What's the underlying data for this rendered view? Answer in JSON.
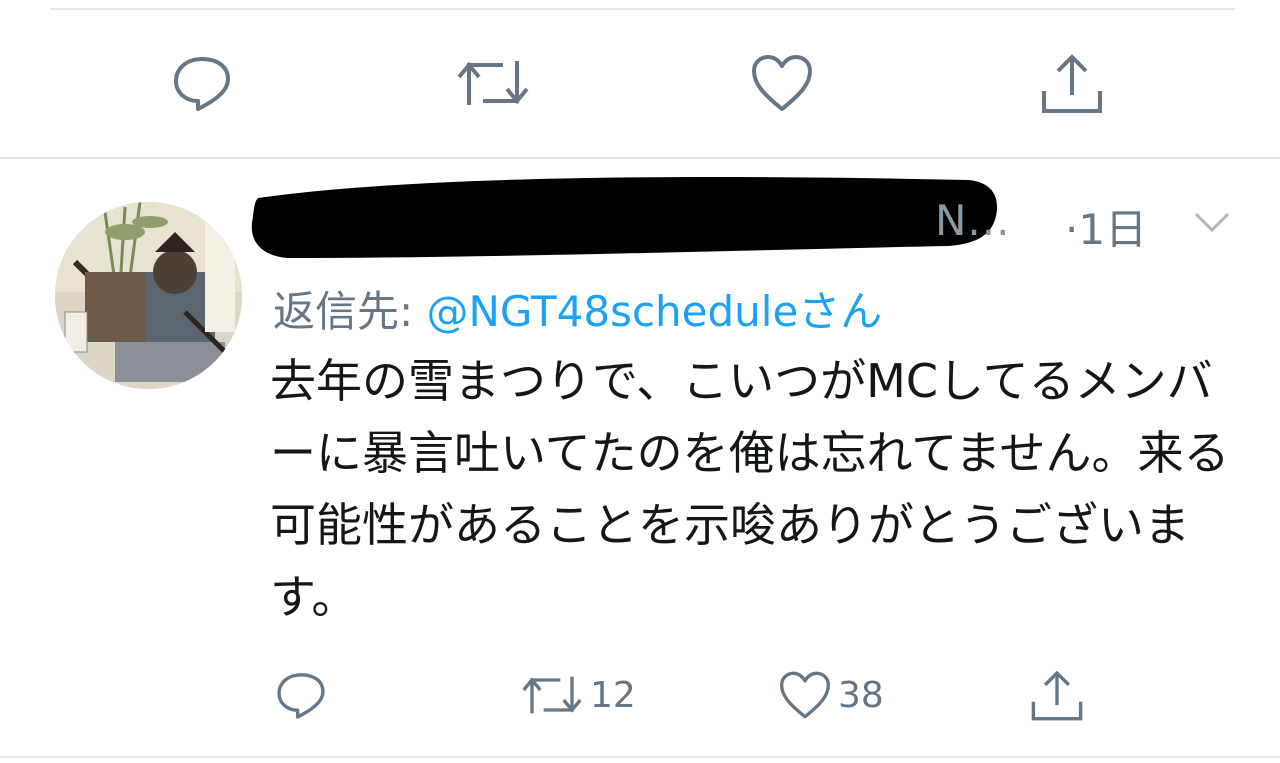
{
  "previous_tweet": {
    "actions": {
      "reply_icon": "reply-icon",
      "retweet_icon": "retweet-icon",
      "like_icon": "heart-icon",
      "share_icon": "share-icon"
    }
  },
  "tweet": {
    "username_visible_tail": "N...",
    "timestamp": "·1日",
    "reply_label": "返信先:",
    "reply_handle": "@NGT48scheduleさん",
    "text": "去年の雪まつりで、こいつがMCしてるメンバーに暴言吐いてたのを俺は忘れてません。来る可能性があることを示唆ありがとうございます。",
    "retweet_count": "12",
    "like_count": "38"
  },
  "colors": {
    "icon_gray": "#657786",
    "link_blue": "#1da1f2",
    "divider": "#e1e8ed",
    "redaction": "#000000"
  }
}
